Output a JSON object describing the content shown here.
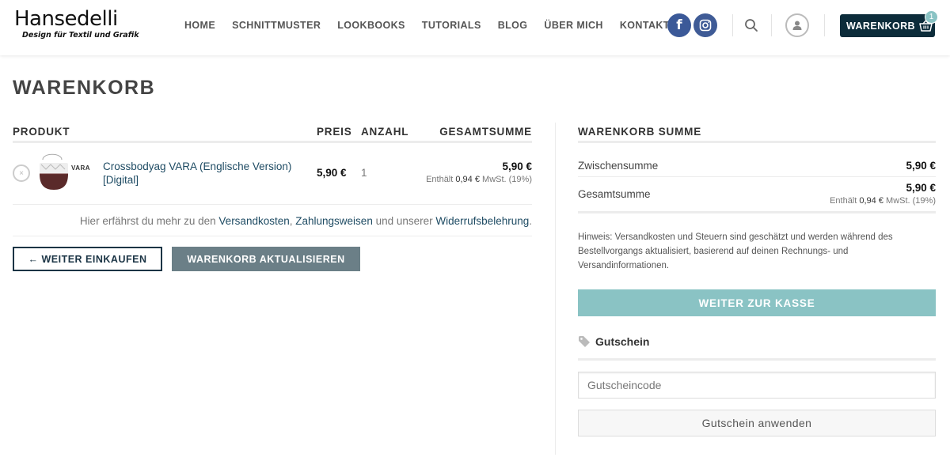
{
  "brand": {
    "name": "Hansedelli",
    "tagline": "Design für Textil und Grafik"
  },
  "nav": {
    "items": [
      "HOME",
      "SCHNITTMUSTER",
      "LOOKBOOKS",
      "TUTORIALS",
      "BLOG",
      "ÜBER MICH",
      "KONTAKT"
    ]
  },
  "header": {
    "facebook_letter": "f",
    "cart_label": "WARENKORB",
    "cart_count": "1"
  },
  "page": {
    "title": "WARENKORB"
  },
  "cart_table": {
    "headers": {
      "product": "PRODUKT",
      "price": "PREIS",
      "quantity": "ANZAHL",
      "subtotal": "GESAMTSUMME"
    },
    "items": [
      {
        "remove_symbol": "×",
        "thumb_text": "VARA",
        "name": "Crossbodyag VARA (Englische Version) [Digital]",
        "price": "5,90 €",
        "quantity": "1",
        "total": "5,90 €",
        "tax_prefix": "Enthält",
        "tax_amount": "0,94 €",
        "tax_suffix": "MwSt. (19%)"
      }
    ]
  },
  "info": {
    "prefix": "Hier erfährst du mehr zu den",
    "link_shipping": "Versandkosten",
    "sep": ",",
    "link_payment": "Zahlungsweisen",
    "middle": "und unserer",
    "link_withdrawal": "Widerrufsbelehrung",
    "suffix": "."
  },
  "actions": {
    "continue_shopping": "← WEITER EINKAUFEN",
    "update_cart": "WARENKORB AKTUALISIEREN"
  },
  "totals": {
    "heading": "WARENKORB SUMME",
    "subtotal_label": "Zwischensumme",
    "subtotal_value": "5,90 €",
    "total_label": "Gesamtsumme",
    "total_value": "5,90 €",
    "tax_prefix": "Enthält",
    "tax_amount": "0,94 €",
    "tax_suffix": "MwSt. (19%)",
    "hint": "Hinweis: Versandkosten und Steuern sind geschätzt und werden während des Bestellvorgangs aktualisiert, basierend auf deinen Rechnungs- und Versandinformationen.",
    "checkout_label": "WEITER ZUR KASSE"
  },
  "coupon": {
    "title": "Gutschein",
    "placeholder": "Gutscheincode",
    "apply_label": "Gutschein anwenden"
  },
  "colors": {
    "accent": "#8ac3c4",
    "dark": "#0c2c3a",
    "link": "#1e4b63",
    "update_button": "#6b7f87"
  }
}
